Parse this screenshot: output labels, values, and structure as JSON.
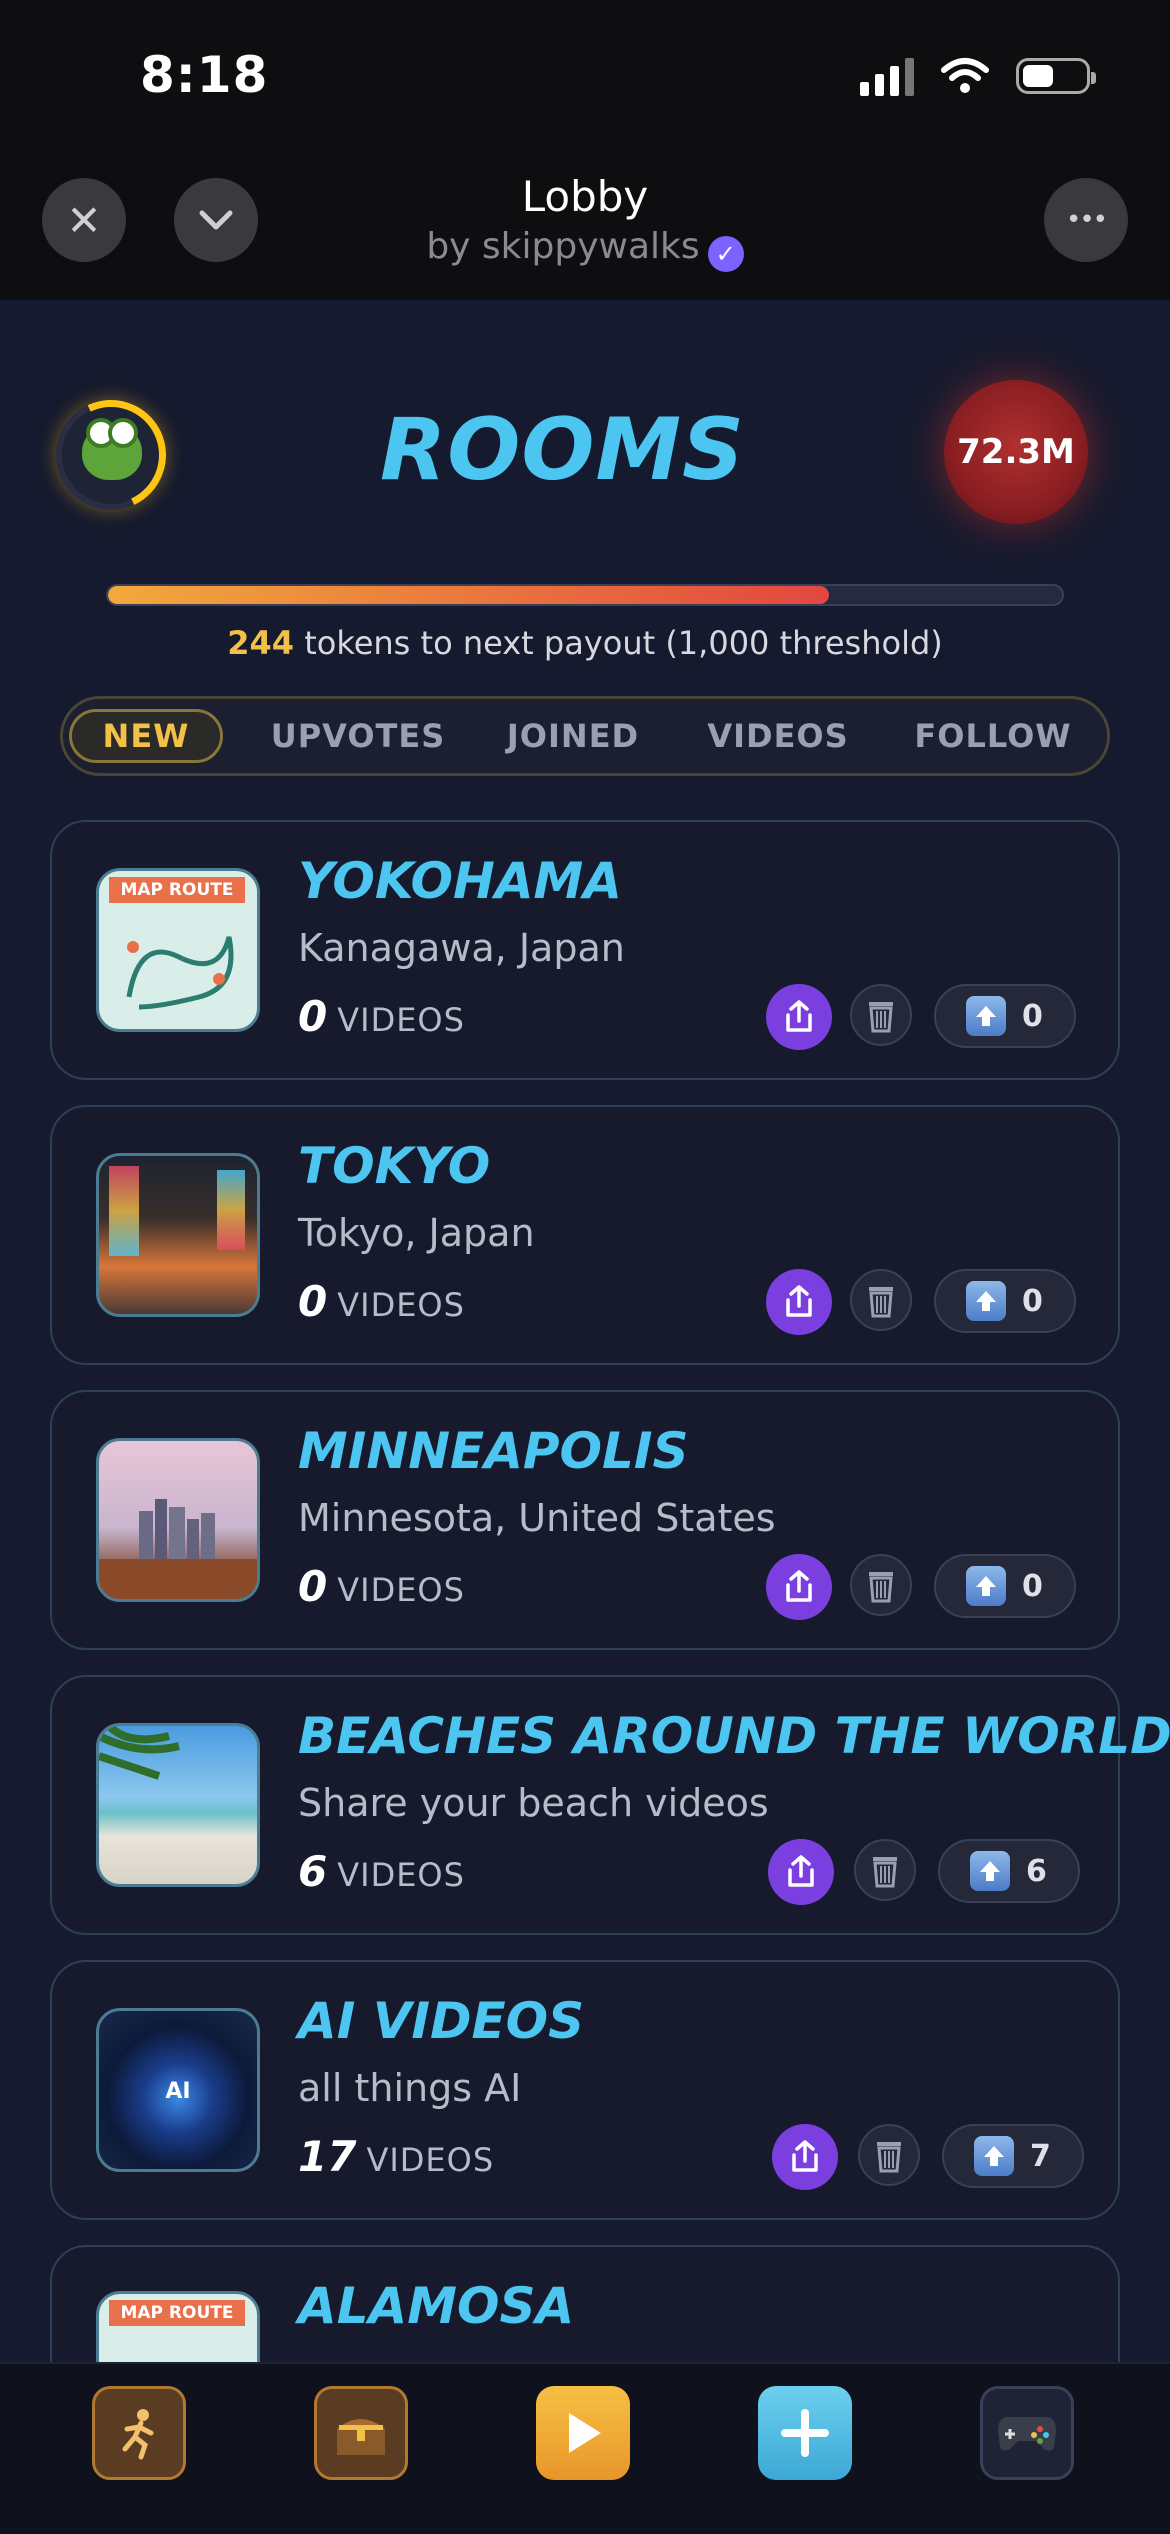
{
  "status_bar": {
    "time": "8:18"
  },
  "nav": {
    "title": "Lobby",
    "subtitle": "by skippywalks",
    "close_label": "✕",
    "collapse_label": "⌄",
    "more_label": "•••"
  },
  "header": {
    "title": "ROOMS",
    "token_balance": "72.3M",
    "progress_fraction": 0.756,
    "progress_tokens": "244",
    "progress_text": "tokens to next payout (1,000 threshold)"
  },
  "tabs": [
    {
      "label": "NEW",
      "active": true
    },
    {
      "label": "UPVOTES",
      "active": false
    },
    {
      "label": "JOINED",
      "active": false
    },
    {
      "label": "VIDEOS",
      "active": false
    },
    {
      "label": "FOLLOW",
      "active": false
    }
  ],
  "rooms": [
    {
      "name": "YOKOHAMA",
      "subtitle": "Kanagawa, Japan",
      "videos": "0",
      "videos_label": "VIDEOS",
      "upvotes": "0",
      "thumb": "map-route"
    },
    {
      "name": "TOKYO",
      "subtitle": "Tokyo, Japan",
      "videos": "0",
      "videos_label": "VIDEOS",
      "upvotes": "0",
      "thumb": "city-street"
    },
    {
      "name": "MINNEAPOLIS",
      "subtitle": "Minnesota, United States",
      "videos": "0",
      "videos_label": "VIDEOS",
      "upvotes": "0",
      "thumb": "skyline"
    },
    {
      "name": "BEACHES AROUND THE WORLD",
      "subtitle": "Share your beach videos",
      "videos": "6",
      "videos_label": "VIDEOS",
      "upvotes": "6",
      "thumb": "beach"
    },
    {
      "name": "AI VIDEOS",
      "subtitle": "all things AI",
      "videos": "17",
      "videos_label": "VIDEOS",
      "upvotes": "7",
      "thumb": "ai-orb"
    },
    {
      "name": "ALAMOSA",
      "subtitle": "",
      "videos": "",
      "videos_label": "",
      "upvotes": "",
      "thumb": "map-route"
    }
  ],
  "thumb_text": {
    "map_route": "MAP ROUTE",
    "ai": "AI"
  },
  "bottom_bar": [
    {
      "icon": "runner-icon"
    },
    {
      "icon": "treasure-chest-icon"
    },
    {
      "icon": "play-icon"
    },
    {
      "icon": "plus-icon"
    },
    {
      "icon": "gamepad-icon"
    }
  ],
  "colors": {
    "accent": "#4cc6f0",
    "gold": "#f3c04a",
    "purple": "#7b3fe0",
    "background": "#161a2e"
  }
}
